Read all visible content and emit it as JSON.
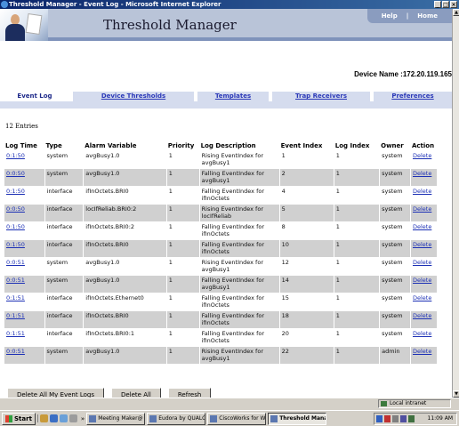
{
  "window": {
    "title": "Threshold Manager - Event Log - Microsoft Internet Explorer"
  },
  "header": {
    "app_title": "Threshold Manager",
    "help_label": "Help",
    "separator": "|",
    "home_label": "Home"
  },
  "device": {
    "label": "Device Name :172.20.119.165"
  },
  "nav": {
    "event_log": "Event Log",
    "device_thresholds": "Device Thresholds",
    "templates": "Templates",
    "trap_receivers": "Trap Receivers",
    "preferences": "Preferences"
  },
  "entries_label": "12 Entries",
  "table": {
    "headers": [
      "Log Time",
      "Type",
      "Alarm Variable",
      "Priority",
      "Log Description",
      "Event Index",
      "Log Index",
      "Owner",
      "Action"
    ],
    "rows": [
      {
        "time": "0:1:50",
        "type": "system",
        "variable": "avgBusy1.0",
        "priority": "1",
        "description": "Rising EventIndex for avgBusy1",
        "event_index": "1",
        "log_index": "1",
        "owner": "system",
        "action": "Delete"
      },
      {
        "time": "0:0:50",
        "type": "system",
        "variable": "avgBusy1.0",
        "priority": "1",
        "description": "Falling EventIndex for avgBusy1",
        "event_index": "2",
        "log_index": "1",
        "owner": "system",
        "action": "Delete"
      },
      {
        "time": "0:1:50",
        "type": "interface",
        "variable": "ifInOctets.BRI0",
        "priority": "1",
        "description": "Falling EventIndex for ifInOctets",
        "event_index": "4",
        "log_index": "1",
        "owner": "system",
        "action": "Delete"
      },
      {
        "time": "0:0:50",
        "type": "interface",
        "variable": "locIfReliab.BRI0:2",
        "priority": "1",
        "description": "Rising EventIndex for locIfReliab",
        "event_index": "5",
        "log_index": "1",
        "owner": "system",
        "action": "Delete"
      },
      {
        "time": "0:1:50",
        "type": "interface",
        "variable": "ifInOctets.BRI0:2",
        "priority": "1",
        "description": "Falling EventIndex for ifInOctets",
        "event_index": "8",
        "log_index": "1",
        "owner": "system",
        "action": "Delete"
      },
      {
        "time": "0:1:50",
        "type": "interface",
        "variable": "ifInOctets.BRI0",
        "priority": "1",
        "description": "Falling EventIndex for ifInOctets",
        "event_index": "10",
        "log_index": "1",
        "owner": "system",
        "action": "Delete"
      },
      {
        "time": "0:0:51",
        "type": "system",
        "variable": "avgBusy1.0",
        "priority": "1",
        "description": "Rising EventIndex for avgBusy1",
        "event_index": "12",
        "log_index": "1",
        "owner": "system",
        "action": "Delete"
      },
      {
        "time": "0:0:51",
        "type": "system",
        "variable": "avgBusy1.0",
        "priority": "1",
        "description": "Falling EventIndex for avgBusy1",
        "event_index": "14",
        "log_index": "1",
        "owner": "system",
        "action": "Delete"
      },
      {
        "time": "0:1:51",
        "type": "interface",
        "variable": "ifInOctets.Ethernet0",
        "priority": "1",
        "description": "Falling EventIndex for ifInOctets",
        "event_index": "15",
        "log_index": "1",
        "owner": "system",
        "action": "Delete"
      },
      {
        "time": "0:1:51",
        "type": "interface",
        "variable": "ifInOctets.BRI0",
        "priority": "1",
        "description": "Falling EventIndex for ifInOctets",
        "event_index": "18",
        "log_index": "1",
        "owner": "system",
        "action": "Delete"
      },
      {
        "time": "0:1:51",
        "type": "interface",
        "variable": "ifInOctets.BRI0:1",
        "priority": "1",
        "description": "Falling EventIndex for ifInOctets",
        "event_index": "20",
        "log_index": "1",
        "owner": "system",
        "action": "Delete"
      },
      {
        "time": "0:0:51",
        "type": "system",
        "variable": "avgBusy1.0",
        "priority": "1",
        "description": "Rising EventIndex for avgBusy1",
        "event_index": "22",
        "log_index": "1",
        "owner": "admin",
        "action": "Delete"
      }
    ]
  },
  "buttons": {
    "delete_mine": "Delete All My Event Logs",
    "delete_all": "Delete All",
    "refresh": "Refresh"
  },
  "statusbar": {
    "zone": "Local intranet"
  },
  "taskbar": {
    "start": "Start",
    "chevron": "»",
    "tasks": [
      "Meeting Maker@ -...",
      "Eudora by QUALC...",
      "CiscoWorks for Wi...",
      "Threshold Mana..."
    ],
    "clock": "11:09 AM"
  },
  "colors": {
    "link": "#1b2fb5",
    "nav_bg": "#d5dcee",
    "banner": "#b9c4d8",
    "row_alt": "#d0d0d0",
    "title_bar": "#0a246a"
  }
}
